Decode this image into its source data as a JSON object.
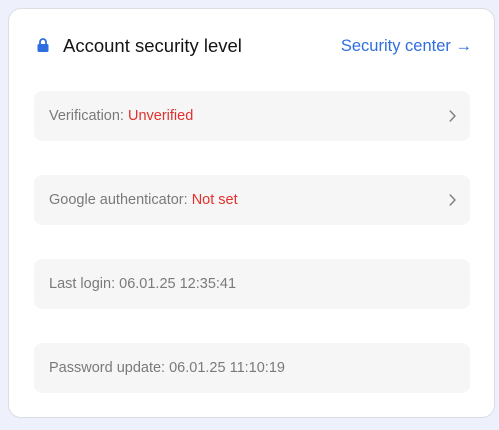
{
  "card": {
    "title": "Account security level",
    "lock_icon": "lock-icon",
    "security_center_link": "Security center →"
  },
  "rows": [
    {
      "label": "Verification: ",
      "value": "Unverified",
      "value_color": "#e2312d",
      "clickable": true,
      "icon": "chevron-right-icon"
    },
    {
      "label": "Google authenticator: ",
      "value": "Not set",
      "value_color": "#e2312d",
      "clickable": true,
      "icon": "chevron-right-icon"
    },
    {
      "label": "Last login: ",
      "value": "06.01.25 12:35:41",
      "clickable": false
    },
    {
      "label": "Password update: ",
      "value": "06.01.25 11:10:19",
      "clickable": false
    }
  ],
  "colors": {
    "accent": "#2f6ee0",
    "warning": "#e2312d"
  }
}
